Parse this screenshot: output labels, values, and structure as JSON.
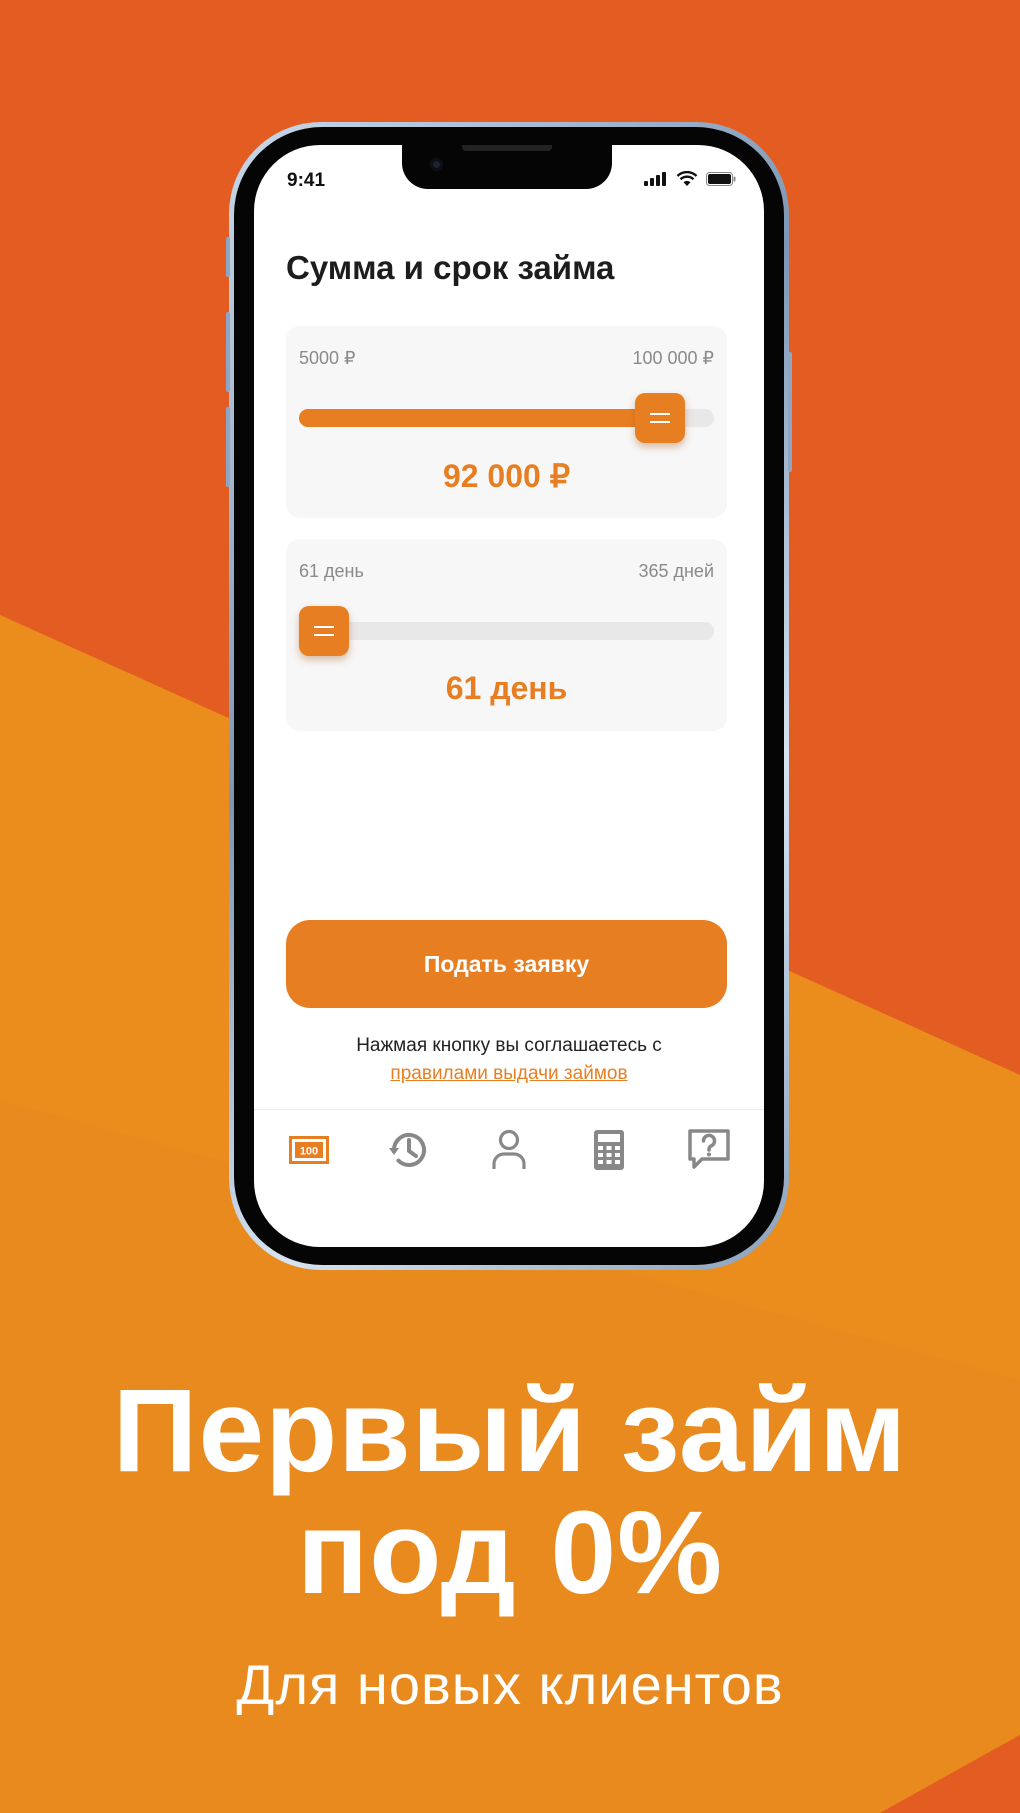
{
  "colors": {
    "accent": "#E87E22",
    "background_top": "#E35D22",
    "background_bottom": "#E8851F"
  },
  "status_bar": {
    "time": "9:41",
    "icons": [
      "signal-icon",
      "wifi-icon",
      "battery-icon"
    ]
  },
  "screen": {
    "title": "Сумма и срок займа",
    "amount_slider": {
      "min_label": "5000 ₽",
      "max_label": "100 000 ₽",
      "value_label": "92 000 ₽",
      "fraction": 0.92
    },
    "term_slider": {
      "min_label": "61 день",
      "max_label": "365 дней",
      "value_label": "61 день",
      "fraction": 0.0
    },
    "submit_label": "Подать заявку",
    "consent_text": "Нажмая кнопку вы соглашаетесь с",
    "consent_link": "правилами выдачи займов"
  },
  "tabbar": {
    "items": [
      {
        "icon": "banknote-icon",
        "text": "100",
        "active": true
      },
      {
        "icon": "history-icon",
        "active": false
      },
      {
        "icon": "profile-icon",
        "active": false
      },
      {
        "icon": "calculator-icon",
        "active": false
      },
      {
        "icon": "help-chat-icon",
        "active": false
      }
    ]
  },
  "promo": {
    "headline_line1": "Первый займ",
    "headline_line2": "под 0%",
    "subtitle": "Для новых клиентов"
  }
}
